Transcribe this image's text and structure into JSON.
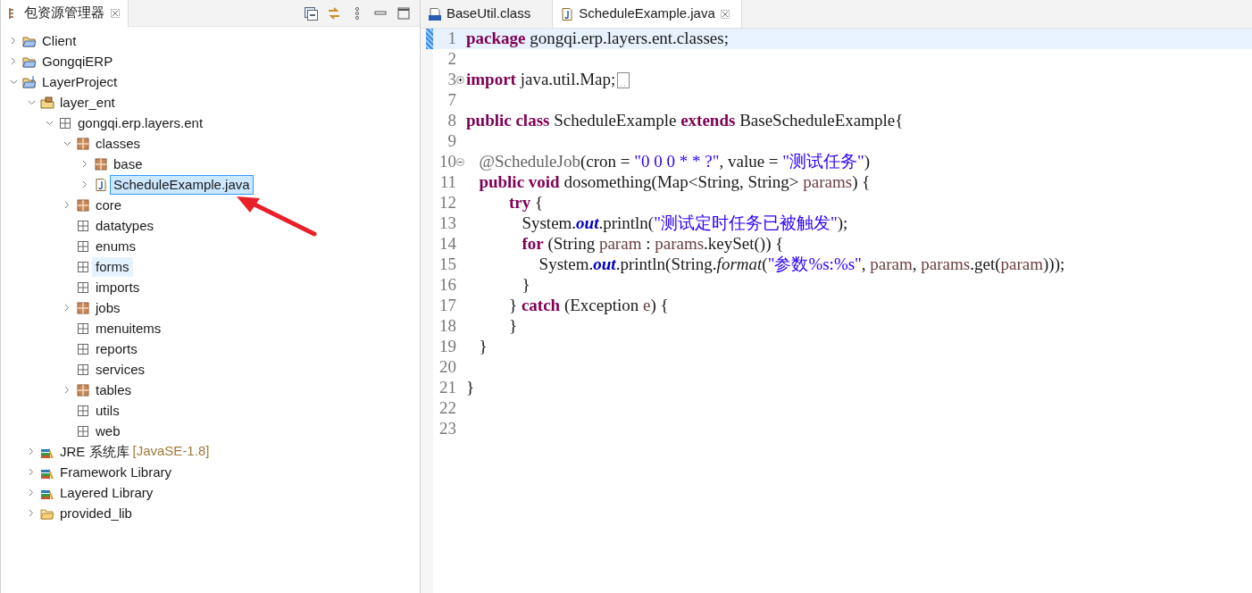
{
  "explorer": {
    "title": "包资源管理器",
    "tree": [
      {
        "label": "Client",
        "kind": "project",
        "expandable": true,
        "expanded": false,
        "selected": false,
        "hovered": false
      },
      {
        "label": "GongqiERP",
        "kind": "project",
        "expandable": true,
        "expanded": false,
        "selected": false,
        "hovered": false
      },
      {
        "label": "LayerProject",
        "kind": "java-project",
        "expandable": true,
        "expanded": true,
        "selected": false,
        "hovered": false,
        "children": [
          {
            "label": "layer_ent",
            "kind": "source-folder",
            "expandable": true,
            "expanded": true,
            "selected": false,
            "hovered": false,
            "children": [
              {
                "label": "gongqi.erp.layers.ent",
                "kind": "package-empty",
                "expandable": true,
                "expanded": true,
                "selected": false,
                "hovered": false,
                "children": [
                  {
                    "label": "classes",
                    "kind": "package",
                    "expandable": true,
                    "expanded": true,
                    "selected": false,
                    "hovered": false,
                    "children": [
                      {
                        "label": "base",
                        "kind": "package",
                        "expandable": true,
                        "expanded": false,
                        "selected": false,
                        "hovered": false
                      },
                      {
                        "label": "ScheduleExample.java",
                        "kind": "java-file",
                        "expandable": true,
                        "expanded": false,
                        "selected": true,
                        "hovered": false
                      }
                    ]
                  },
                  {
                    "label": "core",
                    "kind": "package",
                    "expandable": true,
                    "expanded": false,
                    "selected": false,
                    "hovered": false
                  },
                  {
                    "label": "datatypes",
                    "kind": "package-empty",
                    "expandable": false,
                    "selected": false,
                    "hovered": false
                  },
                  {
                    "label": "enums",
                    "kind": "package-empty",
                    "expandable": false,
                    "selected": false,
                    "hovered": false
                  },
                  {
                    "label": "forms",
                    "kind": "package-empty",
                    "expandable": false,
                    "selected": false,
                    "hovered": true
                  },
                  {
                    "label": "imports",
                    "kind": "package-empty",
                    "expandable": false,
                    "selected": false,
                    "hovered": false
                  },
                  {
                    "label": "jobs",
                    "kind": "package",
                    "expandable": true,
                    "expanded": false,
                    "selected": false,
                    "hovered": false
                  },
                  {
                    "label": "menuitems",
                    "kind": "package-empty",
                    "expandable": false,
                    "selected": false,
                    "hovered": false
                  },
                  {
                    "label": "reports",
                    "kind": "package-empty",
                    "expandable": false,
                    "selected": false,
                    "hovered": false
                  },
                  {
                    "label": "services",
                    "kind": "package-empty",
                    "expandable": false,
                    "selected": false,
                    "hovered": false
                  },
                  {
                    "label": "tables",
                    "kind": "package",
                    "expandable": true,
                    "expanded": false,
                    "selected": false,
                    "hovered": false
                  },
                  {
                    "label": "utils",
                    "kind": "package-empty",
                    "expandable": false,
                    "selected": false,
                    "hovered": false
                  },
                  {
                    "label": "web",
                    "kind": "package-empty",
                    "expandable": false,
                    "selected": false,
                    "hovered": false
                  }
                ]
              }
            ]
          },
          {
            "label": "JRE 系统库",
            "decoration": "[JavaSE-1.8]",
            "kind": "library",
            "expandable": true,
            "expanded": false,
            "selected": false,
            "hovered": false
          },
          {
            "label": "Framework Library",
            "kind": "library",
            "expandable": true,
            "expanded": false,
            "selected": false,
            "hovered": false
          },
          {
            "label": "Layered Library",
            "kind": "library",
            "expandable": true,
            "expanded": false,
            "selected": false,
            "hovered": false
          },
          {
            "label": "provided_lib",
            "kind": "folder",
            "expandable": true,
            "expanded": false,
            "selected": false,
            "hovered": false
          }
        ]
      }
    ]
  },
  "editor": {
    "tabs": [
      {
        "label": "BaseUtil.class",
        "kind": "class-file",
        "selected": false
      },
      {
        "label": "ScheduleExample.java",
        "kind": "java-file",
        "selected": true
      }
    ],
    "lines": [
      {
        "number": "1",
        "kind": "code",
        "current": true,
        "tokens": [
          {
            "kind": "keyword",
            "text": "package"
          },
          {
            "kind": "plain",
            "text": " gongqi.erp.layers.ent.classes;"
          }
        ]
      },
      {
        "number": "2",
        "kind": "code",
        "current": false
      },
      {
        "number": "3",
        "kind": "fold-start",
        "folded": true,
        "current": false,
        "tokens": [
          {
            "kind": "keyword",
            "text": "import"
          },
          {
            "kind": "plain",
            "text": " java.util.Map;"
          }
        ]
      },
      {
        "number": "7",
        "kind": "code",
        "current": false
      },
      {
        "number": "8",
        "kind": "code",
        "current": false,
        "tokens": [
          {
            "kind": "keyword",
            "text": "public class"
          },
          {
            "kind": "plain",
            "text": " ScheduleExample "
          },
          {
            "kind": "keyword",
            "text": "extends"
          },
          {
            "kind": "plain",
            "text": " BaseScheduleExample{"
          }
        ]
      },
      {
        "number": "9",
        "kind": "code",
        "current": false
      },
      {
        "number": "10",
        "kind": "fold-start",
        "folded": false,
        "current": false,
        "tokens": [
          {
            "kind": "annotation",
            "text": "   @ScheduleJob"
          },
          {
            "kind": "plain",
            "text": "(cron = "
          },
          {
            "kind": "string",
            "text": "\"0 0 0 * * ?\""
          },
          {
            "kind": "plain",
            "text": ", value = "
          },
          {
            "kind": "string",
            "text": "\"测试任务\""
          },
          {
            "kind": "plain",
            "text": ")"
          }
        ]
      },
      {
        "number": "11",
        "kind": "code",
        "current": false,
        "tokens": [
          {
            "kind": "keyword",
            "text": "   public void"
          },
          {
            "kind": "plain",
            "text": " dosomething(Map<String, String> "
          },
          {
            "kind": "local",
            "text": "params"
          },
          {
            "kind": "plain",
            "text": ") {"
          }
        ]
      },
      {
        "number": "12",
        "kind": "code",
        "current": false,
        "tokens": [
          {
            "kind": "keyword",
            "text": "          try"
          },
          {
            "kind": "plain",
            "text": " {"
          }
        ]
      },
      {
        "number": "13",
        "kind": "code",
        "current": false,
        "tokens": [
          {
            "kind": "plain",
            "text": "             System."
          },
          {
            "kind": "field",
            "text": "out"
          },
          {
            "kind": "plain",
            "text": ".println("
          },
          {
            "kind": "string",
            "text": "\"测试定时任务已被触发\""
          },
          {
            "kind": "plain",
            "text": ");"
          }
        ]
      },
      {
        "number": "14",
        "kind": "code",
        "current": false,
        "tokens": [
          {
            "kind": "keyword",
            "text": "             for"
          },
          {
            "kind": "plain",
            "text": " (String "
          },
          {
            "kind": "local",
            "text": "param"
          },
          {
            "kind": "plain",
            "text": " : "
          },
          {
            "kind": "local",
            "text": "params"
          },
          {
            "kind": "plain",
            "text": ".keySet()) {"
          }
        ]
      },
      {
        "number": "15",
        "kind": "code",
        "current": false,
        "tokens": [
          {
            "kind": "plain",
            "text": "                 System."
          },
          {
            "kind": "field",
            "text": "out"
          },
          {
            "kind": "plain",
            "text": ".println(String."
          },
          {
            "kind": "static",
            "text": "format"
          },
          {
            "kind": "plain",
            "text": "("
          },
          {
            "kind": "string",
            "text": "\"参数%s:%s\""
          },
          {
            "kind": "plain",
            "text": ", "
          },
          {
            "kind": "local",
            "text": "param"
          },
          {
            "kind": "plain",
            "text": ", "
          },
          {
            "kind": "local",
            "text": "params"
          },
          {
            "kind": "plain",
            "text": ".get("
          },
          {
            "kind": "local",
            "text": "param"
          },
          {
            "kind": "plain",
            "text": ")));"
          }
        ]
      },
      {
        "number": "16",
        "kind": "code",
        "current": false,
        "tokens": [
          {
            "kind": "plain",
            "text": "             }"
          }
        ]
      },
      {
        "number": "17",
        "kind": "code",
        "current": false,
        "tokens": [
          {
            "kind": "plain",
            "text": "          } "
          },
          {
            "kind": "keyword",
            "text": "catch"
          },
          {
            "kind": "plain",
            "text": " (Exception "
          },
          {
            "kind": "local",
            "text": "e"
          },
          {
            "kind": "plain",
            "text": ") {"
          }
        ]
      },
      {
        "number": "18",
        "kind": "code",
        "current": false,
        "tokens": [
          {
            "kind": "plain",
            "text": "          }"
          }
        ]
      },
      {
        "number": "19",
        "kind": "code",
        "current": false,
        "tokens": [
          {
            "kind": "plain",
            "text": "   }"
          }
        ]
      },
      {
        "number": "20",
        "kind": "code",
        "current": false
      },
      {
        "number": "21",
        "kind": "code",
        "current": false,
        "tokens": [
          {
            "kind": "plain",
            "text": "}"
          }
        ]
      },
      {
        "number": "22",
        "kind": "code",
        "current": false
      },
      {
        "number": "23",
        "kind": "code",
        "current": false
      }
    ]
  }
}
